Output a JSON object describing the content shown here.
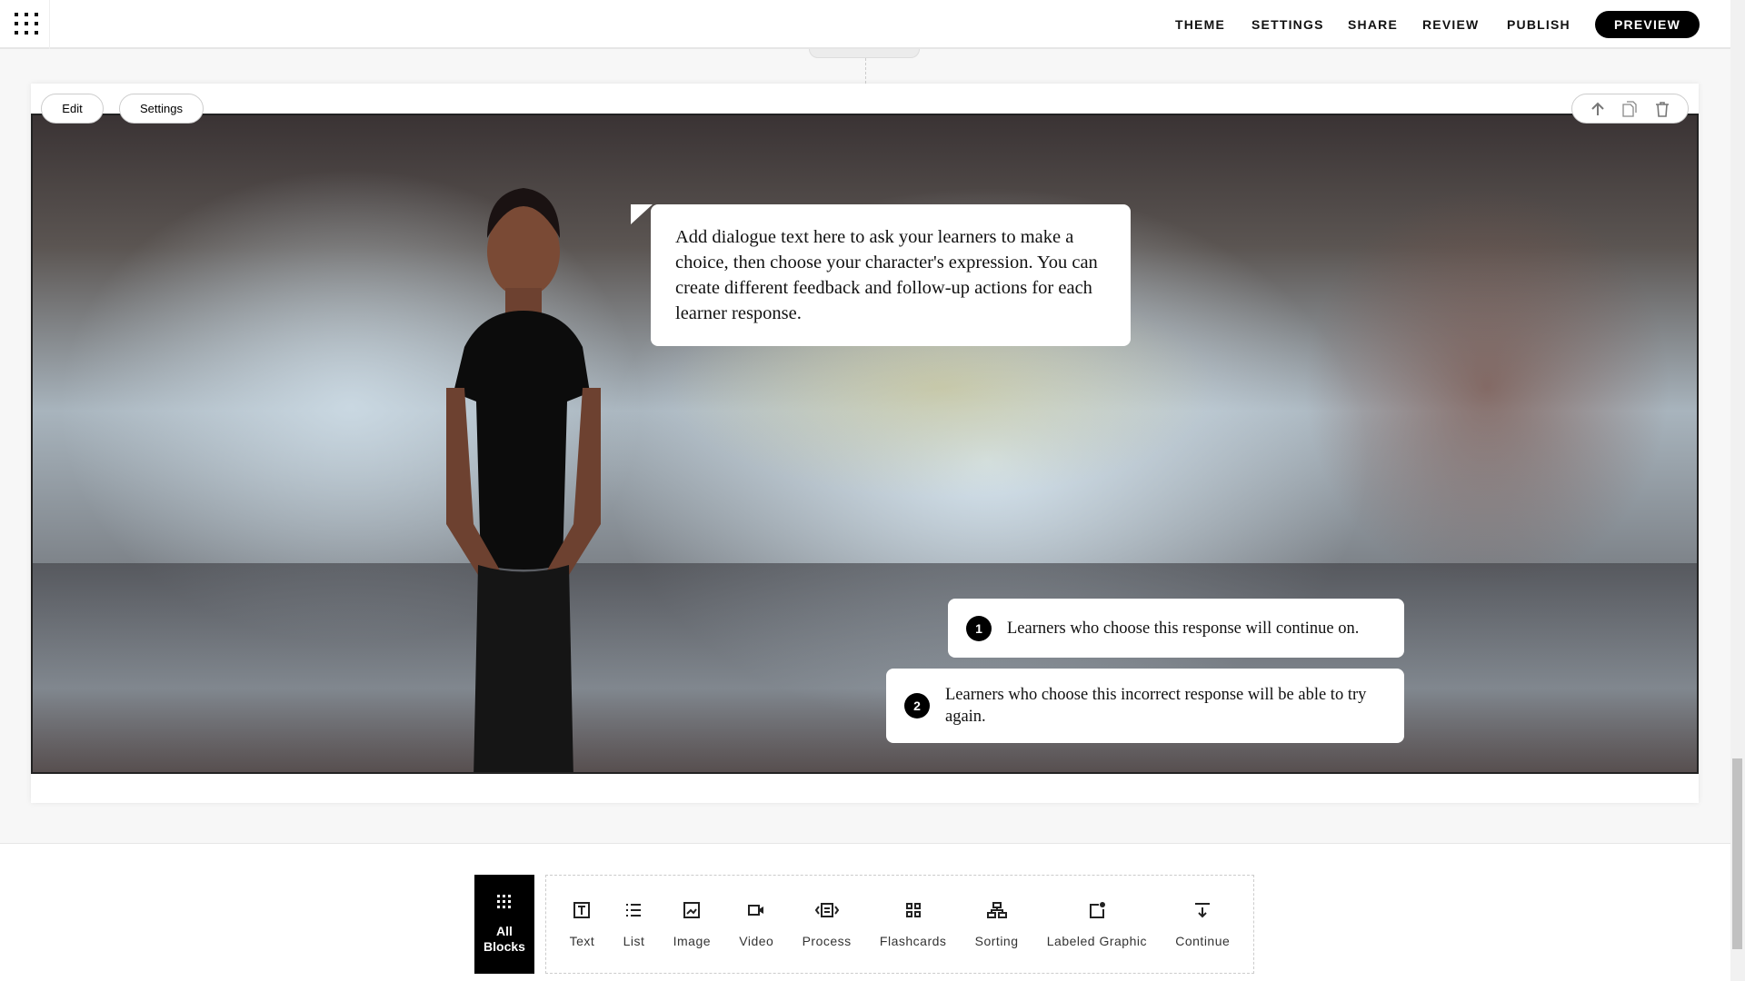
{
  "header": {
    "apps_icon": "grid-icon",
    "nav": [
      "THEME",
      "SETTINGS",
      "SHARE",
      "REVIEW",
      "PUBLISH"
    ],
    "preview_label": "PREVIEW"
  },
  "block": {
    "edit_label": "Edit",
    "settings_label": "Settings",
    "actions": [
      "arrow-up-icon",
      "duplicate-icon",
      "trash-icon"
    ]
  },
  "scenario": {
    "dialogue": "Add dialogue text here to ask your learners to make a choice, then choose your character's expression. You can create different feedback and follow-up actions for each learner response.",
    "responses": [
      {
        "number": "1",
        "text": "Learners who choose this response will continue on."
      },
      {
        "number": "2",
        "text": "Learners who choose this incorrect response will be able to try again."
      }
    ]
  },
  "block_library": {
    "all_blocks_label": [
      "All",
      "Blocks"
    ],
    "items": [
      "Text",
      "List",
      "Image",
      "Video",
      "Process",
      "Flashcards",
      "Sorting",
      "Labeled Graphic",
      "Continue"
    ]
  }
}
